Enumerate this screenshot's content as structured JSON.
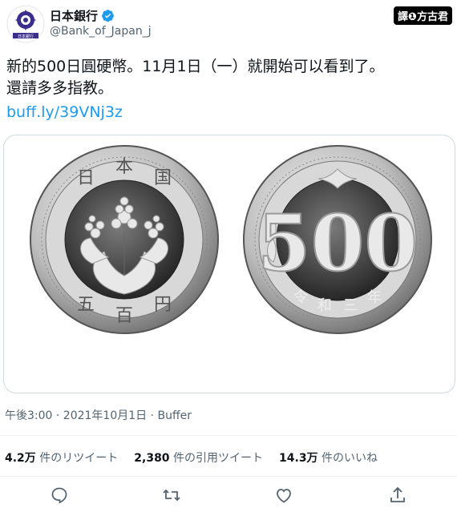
{
  "header": {
    "display_name": "日本銀行",
    "handle": "@Bank_of_Japan_j",
    "watermark": "譯❶方古君",
    "avatar_text": "日本銀行"
  },
  "tweet": {
    "text_line1": "新的500日圓硬幣。11月1日（一）就開始可以看到了。",
    "text_line2": "還請多多指教。",
    "link": "buff.ly/39VNj3z",
    "timestamp": "午後3:00 · 2021年10月1日 · Buffer"
  },
  "coin": {
    "front_top": [
      "日",
      "本",
      "国"
    ],
    "front_bottom": [
      "五",
      "百",
      "円"
    ],
    "back_value": "500",
    "back_bottom": [
      "令",
      "和",
      "三",
      "年"
    ]
  },
  "stats": {
    "retweets_count": "4.2万",
    "retweets_label": " 件のリツイート",
    "quotes_count": "2,380",
    "quotes_label": " 件の引用ツイート",
    "likes_count": "14.3万",
    "likes_label": " 件のいいね"
  },
  "colors": {
    "link": "#1d9bf0",
    "verified": "#1d9bf0",
    "text_secondary": "#536471"
  },
  "icons": [
    "reply-icon",
    "retweet-icon",
    "like-icon",
    "share-icon",
    "verified-icon"
  ]
}
